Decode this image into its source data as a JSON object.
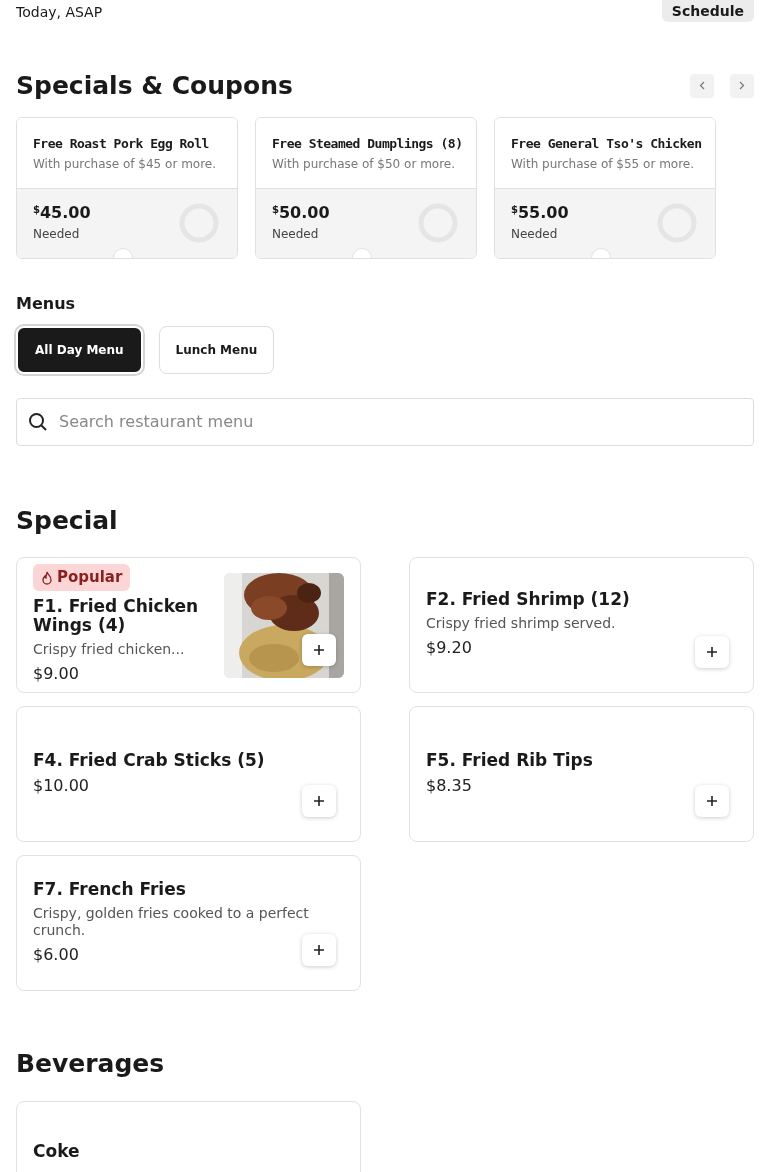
{
  "header": {
    "time": "Today, ASAP",
    "schedule_button": "Schedule"
  },
  "specials": {
    "title": "Specials & Coupons",
    "coupons": [
      {
        "title": "Free Roast Pork Egg Roll",
        "condition": "With purchase of $45 or more.",
        "currency": "$",
        "amount": "45.00",
        "status": "Needed"
      },
      {
        "title": "Free Steamed Dumplings (8)",
        "condition": "With purchase of $50 or more.",
        "currency": "$",
        "amount": "50.00",
        "status": "Needed"
      },
      {
        "title": "Free General Tso's Chicken",
        "condition": "With purchase of $55 or more.",
        "currency": "$",
        "amount": "55.00",
        "status": "Needed"
      }
    ]
  },
  "menus": {
    "title": "Menus",
    "tabs": [
      {
        "label": "All Day Menu",
        "selected": true
      },
      {
        "label": "Lunch Menu",
        "selected": false
      }
    ]
  },
  "search": {
    "placeholder": "Search restaurant menu"
  },
  "sections": [
    {
      "title": "Special",
      "items": [
        {
          "badge": "Popular",
          "name": "F1. Fried Chicken Wings (4)",
          "description": "Crispy fried chicken...",
          "price": "$9.00"
        },
        {
          "name": "F2. Fried Shrimp (12)",
          "description": "Crispy fried shrimp served.",
          "price": "$9.20"
        },
        {
          "name": "F4. Fried Crab Sticks (5)",
          "price": "$10.00"
        },
        {
          "name": "F5. Fried Rib Tips",
          "price": "$8.35"
        },
        {
          "name": "F7. French Fries",
          "description": "Crispy, golden fries cooked to a perfect crunch.",
          "price": "$6.00"
        }
      ]
    },
    {
      "title": "Beverages",
      "items": [
        {
          "name": "Coke"
        }
      ]
    }
  ]
}
